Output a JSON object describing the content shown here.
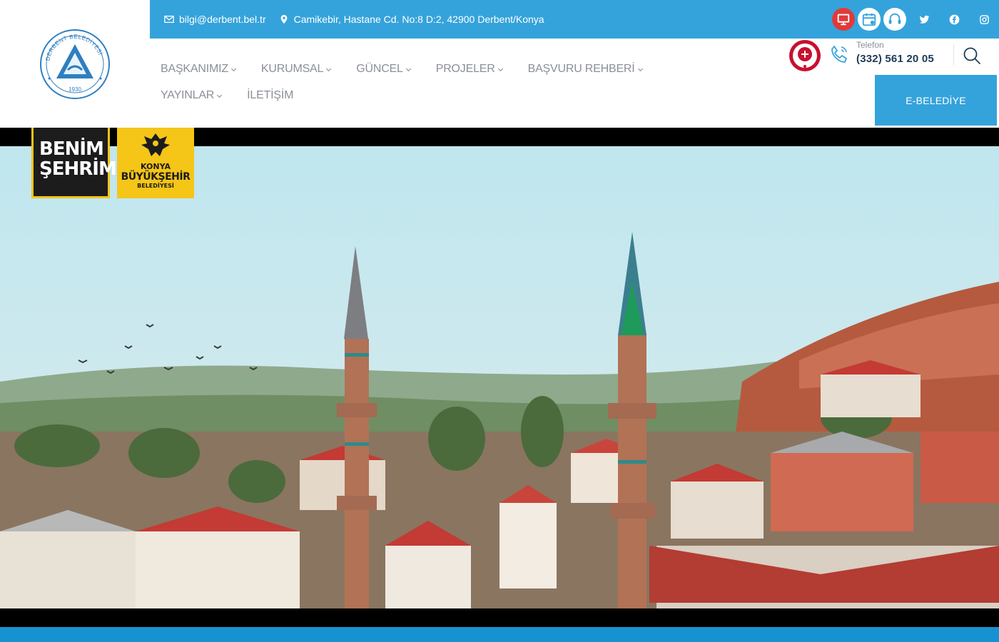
{
  "topbar": {
    "email": "bilgi@derbent.bel.tr",
    "address": "Camikebir, Hastane Cd. No:8 D:2, 42900 Derbent/Konya"
  },
  "logo": {
    "arc_text": "DERBENT BELEDİYESİ",
    "year": "1930"
  },
  "nav": {
    "row1": [
      {
        "label": "BAŞKANIMIZ",
        "has_dropdown": true
      },
      {
        "label": "KURUMSAL",
        "has_dropdown": true
      },
      {
        "label": "GÜNCEL",
        "has_dropdown": true
      },
      {
        "label": "PROJELER",
        "has_dropdown": true
      },
      {
        "label": "BAŞVURU REHBERİ",
        "has_dropdown": true
      }
    ],
    "row2": [
      {
        "label": "YAYINLAR",
        "has_dropdown": true
      },
      {
        "label": "İLETİŞİM",
        "has_dropdown": false
      }
    ]
  },
  "contact": {
    "phone_label": "Telefon",
    "phone_number": "(332) 561 20 05"
  },
  "ebelediye_label": "E-BELEDİYE",
  "hero": {
    "badge_benim_line1": "BENİM",
    "badge_benim_line2": "ŞEHRİM",
    "badge_konya_line1": "KONYA",
    "badge_konya_line2": "BÜYÜKŞEHİR",
    "badge_konya_line3": "BELEDİYESİ"
  },
  "icons": [
    "envelope-icon",
    "location-pin-icon",
    "e-services-icon",
    "calendar-icon",
    "support-headset-icon",
    "twitter-icon",
    "facebook-icon",
    "instagram-icon",
    "phone-icon",
    "search-icon",
    "chevron-down-icon"
  ],
  "colors": {
    "primary": "#35a3db",
    "nav_text": "#8a8f98",
    "phone_text": "#1f3b57",
    "badge_yellow": "#f5c518",
    "bottom_bar": "#1792d0"
  }
}
